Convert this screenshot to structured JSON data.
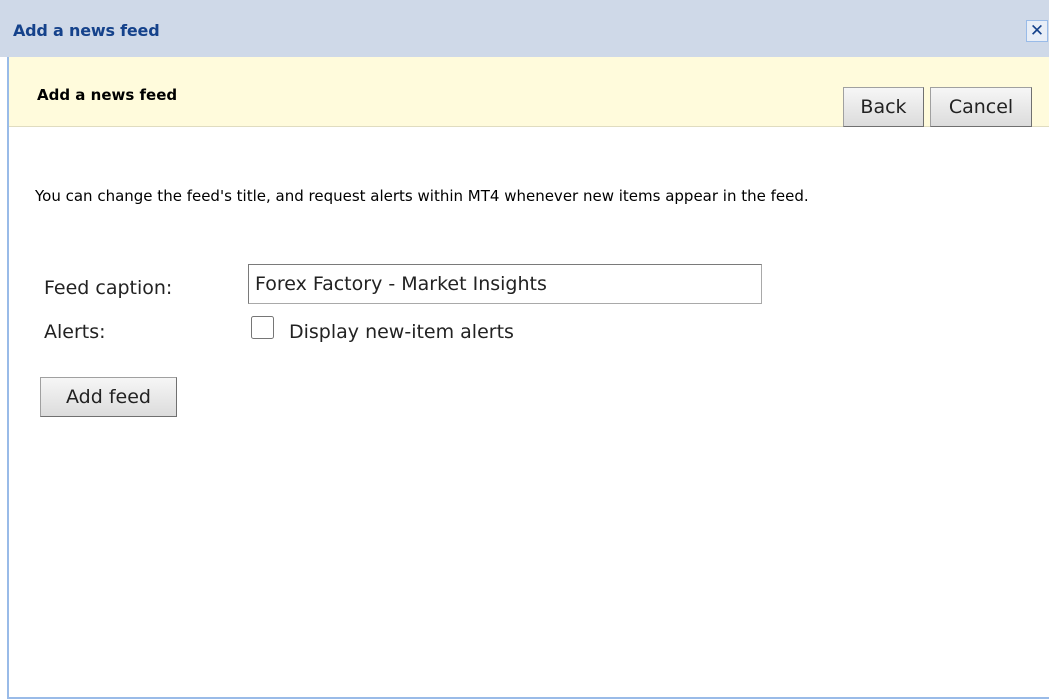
{
  "window": {
    "title": "Add a news feed",
    "close_icon": "close-icon",
    "close_glyph": "✕"
  },
  "header": {
    "title": "Add a news feed",
    "back_label": "Back",
    "cancel_label": "Cancel"
  },
  "form": {
    "description": "You can change the feed's title, and request alerts within MT4 whenever new items appear in the feed.",
    "caption_label": "Feed caption:",
    "caption_value": "Forex Factory - Market Insights",
    "alerts_label": "Alerts:",
    "alerts_checkbox_label": "Display new-item alerts",
    "alerts_checked": false,
    "submit_label": "Add feed"
  },
  "colors": {
    "titlebar_bg": "#cfd9e8",
    "title_text": "#15428b",
    "header_band_bg": "#fffbdc",
    "frame_border": "#99bbe8"
  }
}
